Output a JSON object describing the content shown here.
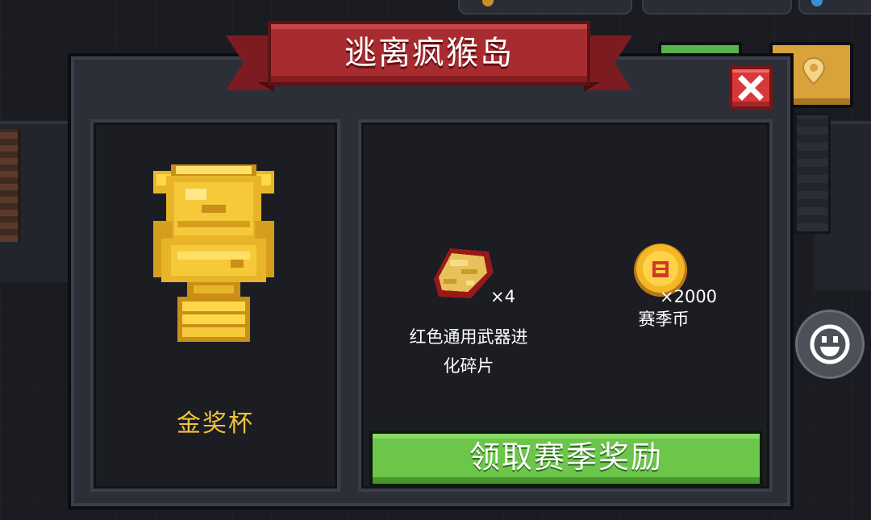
{
  "dialog": {
    "title": "逃离疯猴岛",
    "trophy": {
      "icon": "golden-trophy-icon",
      "name": "金奖杯"
    },
    "rewards": [
      {
        "icon": "red-weapon-fragment-icon",
        "quantity": "×4",
        "label_line1": "红色通用武器进",
        "label_line2": "化碎片"
      },
      {
        "icon": "season-coin-icon",
        "quantity": "×2000",
        "label_line1": "赛季币",
        "label_line2": ""
      }
    ],
    "claim_button_label": "领取赛季奖励",
    "close_icon": "close-icon"
  },
  "hud": {
    "buttons": [
      "green-menu-button",
      "map-pin-icon"
    ],
    "emote_icon": "smiley-icon"
  },
  "colors": {
    "ribbon": "#a82b2f",
    "trophy": "#f2c23c",
    "claim_button": "#6cc64a",
    "close_button": "#d9383a",
    "dialog_bg": "#2c2f38",
    "panel_bg": "#1b1d23"
  }
}
